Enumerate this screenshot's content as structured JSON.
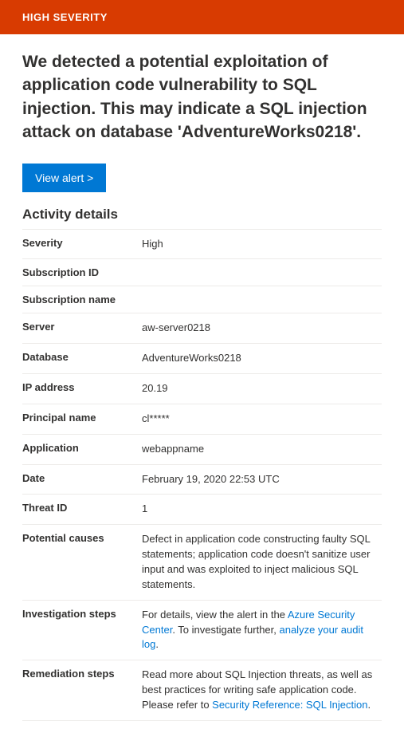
{
  "banner": {
    "severity_label": "HIGH SEVERITY"
  },
  "alert": {
    "title": "We detected a potential exploitation of application code vulnerability to SQL injection. This may indicate a SQL injection attack on database 'AdventureWorks0218'.",
    "view_button": "View alert >"
  },
  "section": {
    "heading": "Activity details"
  },
  "details": {
    "severity": {
      "label": "Severity",
      "value": "High"
    },
    "subscription_id": {
      "label": "Subscription ID",
      "value": ""
    },
    "subscription_name": {
      "label": "Subscription name",
      "value": ""
    },
    "server": {
      "label": "Server",
      "value": "aw-server0218"
    },
    "database": {
      "label": "Database",
      "value": "AdventureWorks0218"
    },
    "ip_address": {
      "label": "IP address",
      "value": "20.19"
    },
    "principal_name": {
      "label": "Principal name",
      "value": "cl*****"
    },
    "application": {
      "label": "Application",
      "value": "webappname"
    },
    "date": {
      "label": "Date",
      "value": "February 19, 2020 22:53 UTC"
    },
    "threat_id": {
      "label": "Threat ID",
      "value": "1"
    },
    "potential_causes": {
      "label": "Potential causes",
      "value": "Defect in application code constructing faulty SQL statements; application code doesn't sanitize user input and was exploited to inject malicious SQL statements."
    },
    "investigation_steps": {
      "label": "Investigation steps",
      "prefix": "For details, view the alert in the ",
      "link1": "Azure Security Center",
      "mid": ". To investigate further, ",
      "link2": "analyze your audit log",
      "suffix": "."
    },
    "remediation_steps": {
      "label": "Remediation steps",
      "prefix": "Read more about SQL Injection threats, as well as best practices for writing safe application code. Please refer to ",
      "link1": "Security Reference: SQL Injection",
      "suffix": "."
    }
  }
}
